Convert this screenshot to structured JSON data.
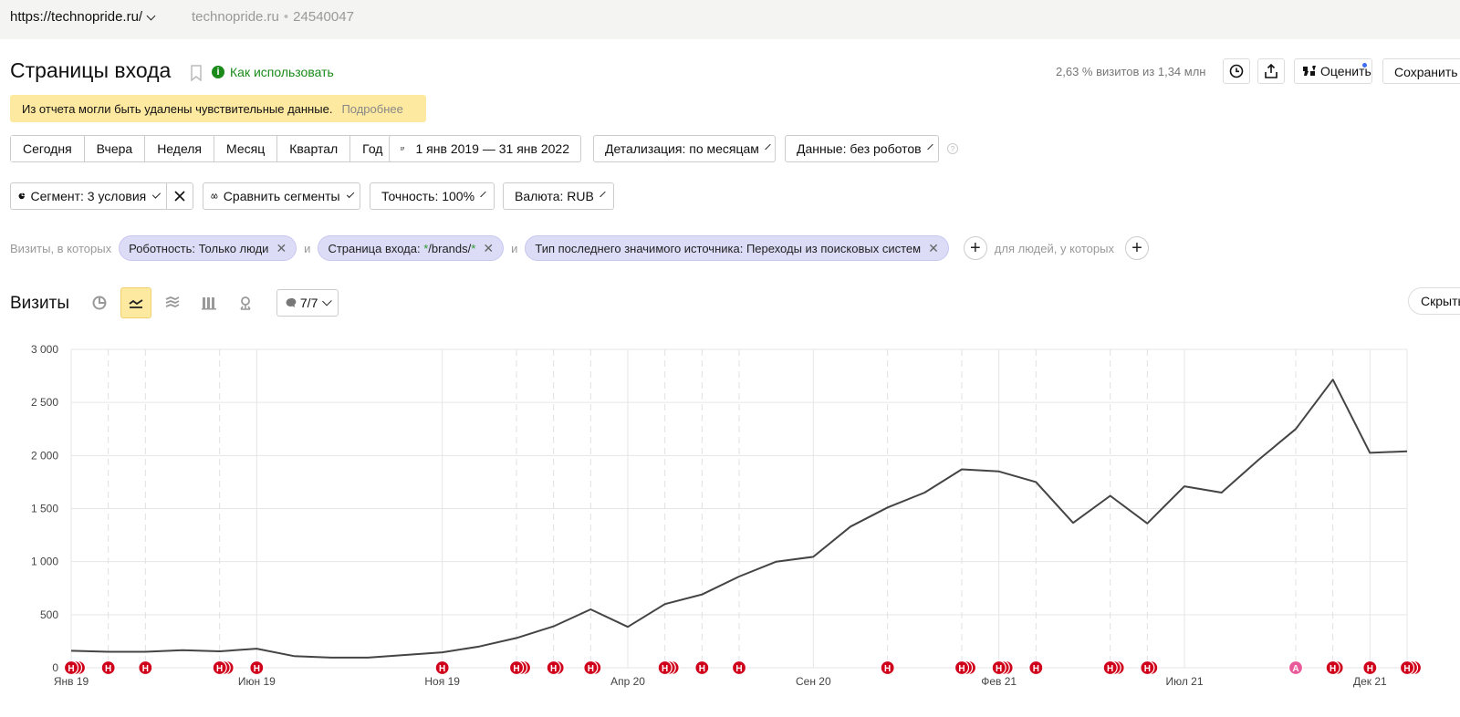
{
  "topbar": {
    "url": "https://technopride.ru/",
    "site": "technopride.ru",
    "counter_id": "24540047"
  },
  "header": {
    "title": "Страницы входа",
    "how_to_use": "Как использовать",
    "visits_share": "2,63 % визитов из 1,34 млн",
    "rate_label": "Оценить",
    "save_label": "Сохранить с"
  },
  "warning": {
    "text": "Из отчета могли быть удалены чувствительные данные.",
    "more": "Подробнее"
  },
  "periods": [
    "Сегодня",
    "Вчера",
    "Неделя",
    "Месяц",
    "Квартал",
    "Год"
  ],
  "date_range": "1 янв 2019 — 31 янв 2022",
  "detail": "Детализация: по месяцам",
  "data_mode": "Данные: без роботов",
  "segment": "Сегмент: 3 условия",
  "compare": "Сравнить сегменты",
  "accuracy": "Точность: 100%",
  "currency": "Валюта: RUB",
  "filters": {
    "prefix": "Визиты, в которых",
    "and": "и",
    "chips": [
      {
        "pre": "Роботность: Только люди",
        "hl": "",
        "post": ""
      },
      {
        "pre": "Страница входа: ",
        "hl": "*",
        "mid": "/brands/",
        "hl2": "*"
      },
      {
        "pre": "Тип последнего значимого источника: Переходы из поисковых систем",
        "hl": "",
        "post": ""
      }
    ],
    "people_label": "для людей, у которых"
  },
  "chart_section": {
    "title": "Визиты",
    "annotations_label": "7/7",
    "hide_label": "Скрыть"
  },
  "colors": {
    "line": "#444444",
    "annotation": "#d0021b",
    "annotation_alt": "#e85a9a",
    "accent_yellow": "#fde9a0"
  },
  "chart_data": {
    "type": "line",
    "title": "",
    "ylim": [
      0,
      3000
    ],
    "yticks": [
      "0",
      "500",
      "1 000",
      "1 500",
      "2 000",
      "2 500",
      "3 000"
    ],
    "ytick_values": [
      0,
      500,
      1000,
      1500,
      2000,
      2500,
      3000
    ],
    "x_labels": [
      "Янв 19",
      "Июн 19",
      "Ноя 19",
      "Апр 20",
      "Сен 20",
      "Фев 21",
      "Июл 21",
      "Дек 21"
    ],
    "x_label_month_index": [
      0,
      5,
      10,
      15,
      20,
      25,
      30,
      35
    ],
    "months": 37,
    "series": [
      {
        "values": [
          160,
          150,
          150,
          165,
          155,
          180,
          110,
          95,
          95,
          120,
          145,
          200,
          280,
          390,
          550,
          385,
          600,
          690,
          860,
          1000,
          1045,
          1330,
          1510,
          1650,
          1870,
          1850,
          1750,
          1365,
          1620,
          1360,
          1710,
          1650,
          1960,
          2250,
          2715,
          2025,
          2040
        ]
      }
    ],
    "grid": true,
    "annotations": [
      {
        "month": 0,
        "count": 3,
        "letter": "Н"
      },
      {
        "month": 1,
        "count": 1,
        "letter": "Н"
      },
      {
        "month": 2,
        "count": 1,
        "letter": "Н"
      },
      {
        "month": 4,
        "count": 3,
        "letter": "Н"
      },
      {
        "month": 5,
        "count": 1,
        "letter": "Н"
      },
      {
        "month": 10,
        "count": 1,
        "letter": "Н"
      },
      {
        "month": 12,
        "count": 3,
        "letter": "Н"
      },
      {
        "month": 13,
        "count": 2,
        "letter": "Н"
      },
      {
        "month": 14,
        "count": 2,
        "letter": "Н"
      },
      {
        "month": 16,
        "count": 3,
        "letter": "Н"
      },
      {
        "month": 17,
        "count": 1,
        "letter": "Н"
      },
      {
        "month": 18,
        "count": 1,
        "letter": "Н"
      },
      {
        "month": 22,
        "count": 1,
        "letter": "Н"
      },
      {
        "month": 24,
        "count": 3,
        "letter": "Н"
      },
      {
        "month": 25,
        "count": 3,
        "letter": "Н"
      },
      {
        "month": 26,
        "count": 1,
        "letter": "Н"
      },
      {
        "month": 28,
        "count": 3,
        "letter": "Н"
      },
      {
        "month": 29,
        "count": 2,
        "letter": "Н"
      },
      {
        "month": 33,
        "count": 1,
        "letter": "А",
        "alt": true
      },
      {
        "month": 34,
        "count": 2,
        "letter": "Н"
      },
      {
        "month": 35,
        "count": 1,
        "letter": "Н"
      },
      {
        "month": 36,
        "count": 3,
        "letter": "Н"
      }
    ],
    "dashed_month_index": [
      1,
      2,
      4,
      12,
      13,
      14,
      16,
      17,
      18,
      22,
      24,
      26,
      28,
      29,
      33,
      34
    ]
  }
}
